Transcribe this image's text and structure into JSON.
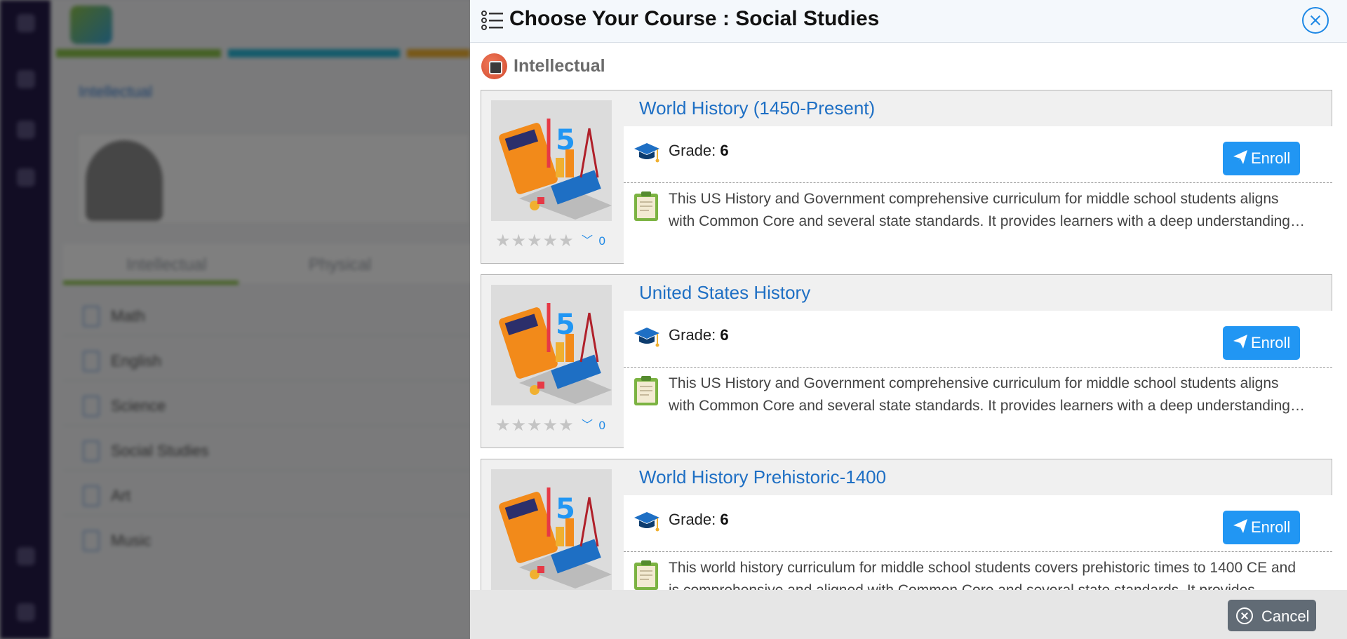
{
  "modal": {
    "title": "Choose Your Course : Social Studies",
    "category": "Intellectual",
    "grade_label": "Grade:",
    "enroll_label": "Enroll",
    "cancel_label": "Cancel"
  },
  "courses": [
    {
      "title": "World History (1450-Present)",
      "grade": "6",
      "rating_count": "0",
      "description": "This US History and Government comprehensive curriculum for middle school students aligns with Common Core and several state standards. It provides learners with a deep understanding of US..."
    },
    {
      "title": "United States History",
      "grade": "6",
      "rating_count": "0",
      "description": "This US History and Government comprehensive curriculum for middle school students aligns with Common Core and several state standards. It provides learners with a deep understanding of US..."
    },
    {
      "title": "World History Prehistoric-1400",
      "grade": "6",
      "rating_count": "0",
      "description": "This world history curriculum for middle school students covers prehistoric times to 1400 CE and is comprehensive and aligned with Common Core and several state standards. It provides learners..."
    }
  ],
  "background": {
    "breadcrumb": "Intellectual",
    "tabs": [
      "Intellectual",
      "Physical"
    ],
    "subjects": [
      "Math",
      "English",
      "Science",
      "Social Studies",
      "Art",
      "Music"
    ]
  },
  "icons": {
    "header": "list-icon",
    "close": "close-circle-icon",
    "category": "brain-icon",
    "grade": "graduation-cap-icon",
    "description": "clipboard-icon",
    "enroll": "paper-plane-icon",
    "cancel": "close-circle-icon"
  },
  "colors": {
    "accent": "#2196f3",
    "title_link": "#1e6fc4",
    "sidebar": "#241a48",
    "cancel": "#616b75"
  }
}
